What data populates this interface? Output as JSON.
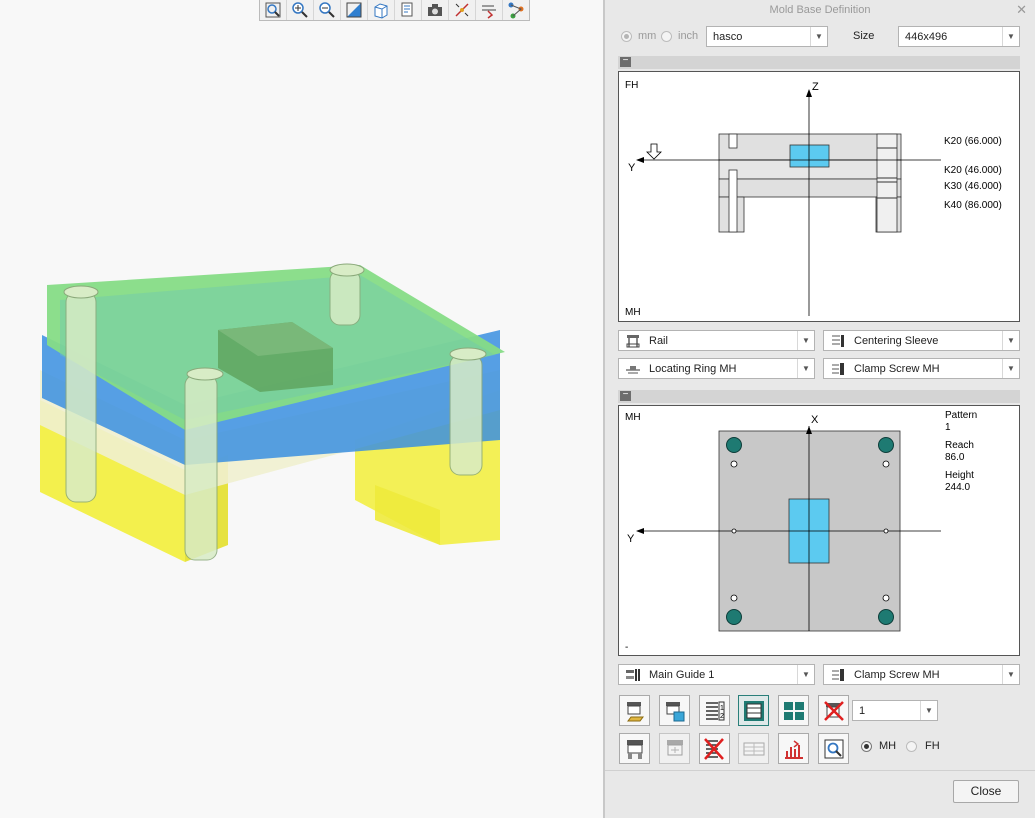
{
  "toolbar": {
    "icons": [
      "zoom-fit-icon",
      "zoom-in-icon",
      "zoom-out-icon",
      "shading-icon",
      "view-cube-icon",
      "saved-views-icon",
      "camera-icon",
      "spin-center-icon",
      "display-style-icon",
      "datum-display-icon"
    ]
  },
  "dialog": {
    "title": "Mold Base Definition",
    "units": {
      "mm": "mm",
      "inch": "inch"
    },
    "vendor": "hasco",
    "size_label": "Size",
    "size_value": "446x496",
    "side_view": {
      "top_left": "FH",
      "bottom_left": "MH",
      "axis_z": "Z",
      "axis_y": "Y",
      "plates": [
        "K20 (66.000)",
        "K20 (46.000)",
        "K30 (46.000)",
        "K40 (86.000)"
      ]
    },
    "combos_top": [
      {
        "value": "Rail",
        "icon": "rail-icon"
      },
      {
        "value": "Centering Sleeve",
        "icon": "centering-sleeve-icon"
      },
      {
        "value": "Locating Ring MH",
        "icon": "locating-ring-icon"
      },
      {
        "value": "Clamp Screw MH",
        "icon": "clamp-screw-icon"
      }
    ],
    "top_view": {
      "top_left": "MH",
      "bottom_left": "-",
      "axis_x": "X",
      "axis_y": "Y",
      "pattern_label": "Pattern",
      "pattern_value": "1",
      "reach_label": "Reach",
      "reach_value": "86.0",
      "height_label": "Height",
      "height_value": "244.0"
    },
    "combos_bottom": [
      {
        "value": "Main Guide 1",
        "icon": "main-guide-icon"
      },
      {
        "value": "Clamp Screw MH",
        "icon": "clamp-screw-icon"
      }
    ],
    "count_value": "1",
    "side_options": {
      "mh": "MH",
      "fh": "FH"
    },
    "close_label": "Close"
  }
}
